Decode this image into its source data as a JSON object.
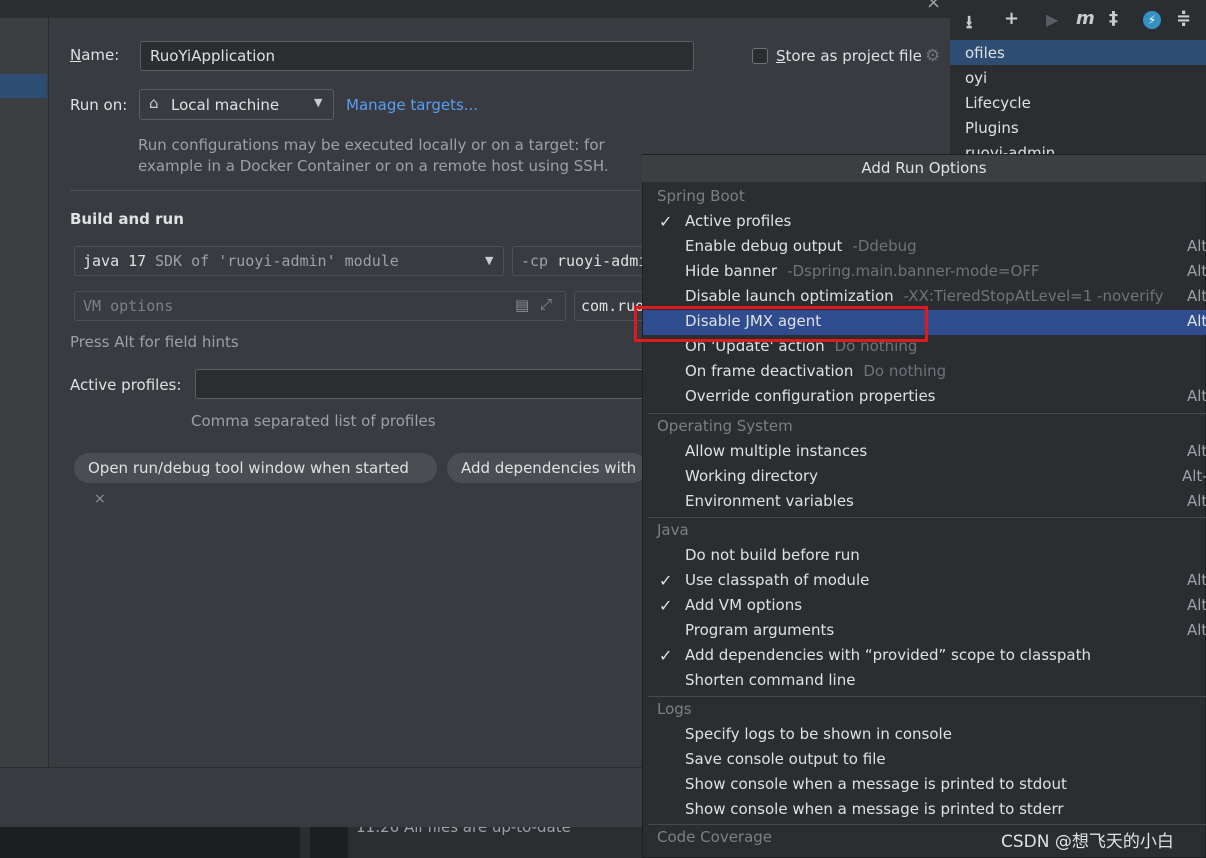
{
  "dialog": {
    "name_label": "Name:",
    "name_value": "RuoYiApplication",
    "store_label": "Store as project file",
    "run_on_label": "Run on:",
    "run_on_value": "Local machine",
    "manage_targets": "Manage targets...",
    "run_info_line1": "Run configurations may be executed locally or on a target: for",
    "run_info_line2": "example in a Docker Container or on a remote host using SSH.",
    "build_and_run": "Build and run",
    "jdk_value_a": "java 17",
    "jdk_value_b": "SDK of 'ruoyi-admin' module",
    "cp_prefix": "-cp",
    "cp_value": "ruoyi-admi",
    "vm_options_placeholder": "VM options",
    "main_class_partial": "com.ruo",
    "alt_hint": "Press Alt for field hints",
    "active_profiles_label": "Active profiles:",
    "active_profiles_value": "",
    "profiles_hint": "Comma separated list of profiles",
    "chip_open_tool": "Open run/debug tool window when started",
    "chip_add_deps": "Add dependencies with “"
  },
  "background": {
    "tree_items": [
      "ofiles",
      "oyi",
      "Lifecycle",
      "Plugins",
      "ruoyi-admin"
    ],
    "console_text": "11:26  All files are up-to-date",
    "watermark": "CSDN @想飞天的小白"
  },
  "popup": {
    "title": "Add Run Options",
    "groups": [
      {
        "name": "Spring Boot",
        "items": [
          {
            "label": "Active profiles",
            "hint": "",
            "checked": true,
            "shortcut": ""
          },
          {
            "label": "Enable debug output",
            "hint": "-Ddebug",
            "checked": false,
            "shortcut": "Alt"
          },
          {
            "label": "Hide banner",
            "hint": "-Dspring.main.banner-mode=OFF",
            "checked": false,
            "shortcut": "Alt"
          },
          {
            "label": "Disable launch optimization",
            "hint": "-XX:TieredStopAtLevel=1 -noverify",
            "checked": false,
            "shortcut": "Alt"
          },
          {
            "label": "Disable JMX agent",
            "hint": "",
            "checked": false,
            "shortcut": "Alt",
            "selected": true
          },
          {
            "label": "On 'Update' action",
            "hint": "Do nothing",
            "checked": false,
            "shortcut": ""
          },
          {
            "label": "On frame deactivation",
            "hint": "Do nothing",
            "checked": false,
            "shortcut": ""
          },
          {
            "label": "Override configuration properties",
            "hint": "",
            "checked": false,
            "shortcut": "Alt"
          }
        ]
      },
      {
        "name": "Operating System",
        "items": [
          {
            "label": "Allow multiple instances",
            "hint": "",
            "checked": false,
            "shortcut": "Alt"
          },
          {
            "label": "Working directory",
            "hint": "",
            "checked": false,
            "shortcut": "Alt-"
          },
          {
            "label": "Environment variables",
            "hint": "",
            "checked": false,
            "shortcut": "Alt"
          }
        ]
      },
      {
        "name": "Java",
        "items": [
          {
            "label": "Do not build before run",
            "hint": "",
            "checked": false,
            "shortcut": ""
          },
          {
            "label": "Use classpath of module",
            "hint": "",
            "checked": true,
            "shortcut": "Alt"
          },
          {
            "label": "Add VM options",
            "hint": "",
            "checked": true,
            "shortcut": "Alt"
          },
          {
            "label": "Program arguments",
            "hint": "",
            "checked": false,
            "shortcut": "Alt"
          },
          {
            "label": "Add dependencies with “provided” scope to classpath",
            "hint": "",
            "checked": true,
            "shortcut": ""
          },
          {
            "label": "Shorten command line",
            "hint": "",
            "checked": false,
            "shortcut": ""
          }
        ]
      },
      {
        "name": "Logs",
        "items": [
          {
            "label": "Specify logs to be shown in console",
            "hint": "",
            "checked": false,
            "shortcut": ""
          },
          {
            "label": "Save console output to file",
            "hint": "",
            "checked": false,
            "shortcut": ""
          },
          {
            "label": "Show console when a message is printed to stdout",
            "hint": "",
            "checked": false,
            "shortcut": ""
          },
          {
            "label": "Show console when a message is printed to stderr",
            "hint": "",
            "checked": false,
            "shortcut": ""
          }
        ]
      },
      {
        "name": "Code Coverage",
        "items": []
      }
    ]
  },
  "colors": {
    "selection": "#2e4c8e",
    "highlight_box": "#e01a1a",
    "link": "#589df6"
  }
}
